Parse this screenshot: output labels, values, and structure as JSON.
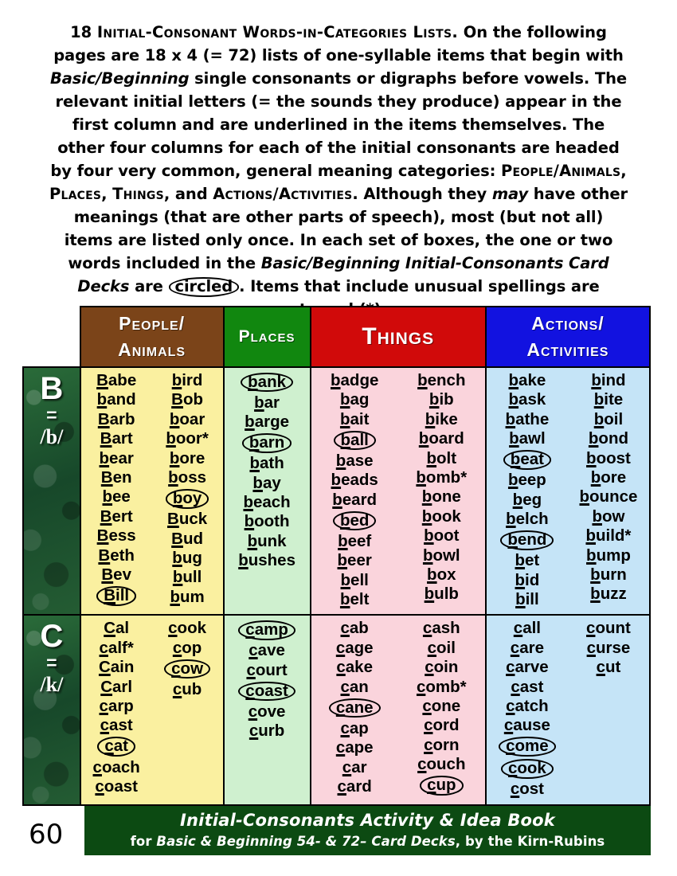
{
  "intro": {
    "lead_number": "18",
    "lead_title": "Initial-Consonant Words-in-Categories Lists.",
    "s1": " On the following pages are 18 x 4 (= 72) lists of one-syllable items that begin with ",
    "s1_it": "Basic/Beginning",
    "s2": " single consonants or digraphs before vowels. The relevant initial letters (= the sounds they produce) appear in the first column and are underlined in the items themselves. The other four columns for each of the initial consonants are headed by four very common, general meaning categories: ",
    "cat1": "People/Animals",
    "cat_sep1": ", ",
    "cat2": "Places",
    "cat_sep2": ", ",
    "cat3": "Things",
    "cat_sep3": ", and ",
    "cat4": "Actions/Activities",
    "s3": ". Although they ",
    "s3_it": "may",
    "s4": " have other meanings (that are other parts of speech), most (but not all) items are listed only once. In each set of boxes, the one or two words included in the ",
    "s4_it": "Basic/Beginning Initial-Consonants Card Decks",
    "s5": " are ",
    "s5_circled": "circled",
    "s6": ". Items that include unusual spellings are starred (*)."
  },
  "table": {
    "headers": [
      {
        "line1": "People/",
        "line2": "Animals",
        "color": "#7B4419"
      },
      {
        "line1": "Places",
        "line2": "",
        "color": "#11870F"
      },
      {
        "line1": "Things",
        "line2": "",
        "color": "#D10A0A"
      },
      {
        "line1": "Actions/",
        "line2": "Activities",
        "color": "#1212E0"
      }
    ],
    "rows": [
      {
        "letter": "B",
        "equals": "=",
        "phoneme": "/b/",
        "people": {
          "left": [
            {
              "t": "Babe",
              "u": "B",
              "circled": false
            },
            {
              "t": "band",
              "u": "b",
              "circled": false
            },
            {
              "t": "Barb",
              "u": "B",
              "circled": false
            },
            {
              "t": "Bart",
              "u": "B",
              "circled": false
            },
            {
              "t": "bear",
              "u": "b",
              "circled": false
            },
            {
              "t": "Ben",
              "u": "B",
              "circled": false
            },
            {
              "t": "bee",
              "u": "b",
              "circled": false
            },
            {
              "t": "Bert",
              "u": "B",
              "circled": false
            },
            {
              "t": "Bess",
              "u": "B",
              "circled": false
            },
            {
              "t": "Beth",
              "u": "B",
              "circled": false
            },
            {
              "t": "Bev",
              "u": "B",
              "circled": false
            },
            {
              "t": "Bill",
              "u": "B",
              "circled": true
            }
          ],
          "right": [
            {
              "t": "bird",
              "u": "b",
              "circled": false
            },
            {
              "t": "Bob",
              "u": "B",
              "circled": false
            },
            {
              "t": "boar",
              "u": "b",
              "circled": false
            },
            {
              "t": "boor*",
              "u": "b",
              "circled": false
            },
            {
              "t": "bore",
              "u": "b",
              "circled": false
            },
            {
              "t": "boss",
              "u": "b",
              "circled": false
            },
            {
              "t": "boy",
              "u": "b",
              "circled": true
            },
            {
              "t": "Buck",
              "u": "B",
              "circled": false
            },
            {
              "t": "Bud",
              "u": "B",
              "circled": false
            },
            {
              "t": "bug",
              "u": "b",
              "circled": false
            },
            {
              "t": "bull",
              "u": "b",
              "circled": false
            },
            {
              "t": "bum",
              "u": "b",
              "circled": false
            }
          ]
        },
        "places": {
          "single": [
            {
              "t": "bank",
              "u": "b",
              "circled": true
            },
            {
              "t": "bar",
              "u": "b",
              "circled": false
            },
            {
              "t": "barge",
              "u": "b",
              "circled": false
            },
            {
              "t": "barn",
              "u": "b",
              "circled": true
            },
            {
              "t": "bath",
              "u": "b",
              "circled": false
            },
            {
              "t": "bay",
              "u": "b",
              "circled": false
            },
            {
              "t": "beach",
              "u": "b",
              "circled": false
            },
            {
              "t": "booth",
              "u": "b",
              "circled": false
            },
            {
              "t": "bunk",
              "u": "b",
              "circled": false
            },
            {
              "t": "bushes",
              "u": "b",
              "circled": false
            }
          ]
        },
        "things": {
          "left": [
            {
              "t": "badge",
              "u": "b",
              "circled": false
            },
            {
              "t": "bag",
              "u": "b",
              "circled": false
            },
            {
              "t": "bait",
              "u": "b",
              "circled": false
            },
            {
              "t": "ball",
              "u": "b",
              "circled": true
            },
            {
              "t": "base",
              "u": "b",
              "circled": false
            },
            {
              "t": "beads",
              "u": "b",
              "circled": false
            },
            {
              "t": "beard",
              "u": "b",
              "circled": false
            },
            {
              "t": "bed",
              "u": "b",
              "circled": true
            },
            {
              "t": "beef",
              "u": "b",
              "circled": false
            },
            {
              "t": "beer",
              "u": "b",
              "circled": false
            },
            {
              "t": "bell",
              "u": "b",
              "circled": false
            },
            {
              "t": "belt",
              "u": "b",
              "circled": false
            }
          ],
          "right": [
            {
              "t": "bench",
              "u": "b",
              "circled": false
            },
            {
              "t": "bib",
              "u": "b",
              "circled": false
            },
            {
              "t": "bike",
              "u": "b",
              "circled": false
            },
            {
              "t": "board",
              "u": "b",
              "circled": false
            },
            {
              "t": "bolt",
              "u": "b",
              "circled": false
            },
            {
              "t": "bomb*",
              "u": "b",
              "circled": false
            },
            {
              "t": "bone",
              "u": "b",
              "circled": false
            },
            {
              "t": "book",
              "u": "b",
              "circled": false
            },
            {
              "t": "boot",
              "u": "b",
              "circled": false
            },
            {
              "t": "bowl",
              "u": "b",
              "circled": false
            },
            {
              "t": "box",
              "u": "b",
              "circled": false
            },
            {
              "t": "bulb",
              "u": "b",
              "circled": false
            }
          ]
        },
        "actions": {
          "left": [
            {
              "t": "bake",
              "u": "b",
              "circled": false
            },
            {
              "t": "bask",
              "u": "b",
              "circled": false
            },
            {
              "t": "bathe",
              "u": "b",
              "circled": false
            },
            {
              "t": "bawl",
              "u": "b",
              "circled": false
            },
            {
              "t": "beat",
              "u": "b",
              "circled": true
            },
            {
              "t": "beep",
              "u": "b",
              "circled": false
            },
            {
              "t": "beg",
              "u": "b",
              "circled": false
            },
            {
              "t": "belch",
              "u": "b",
              "circled": false
            },
            {
              "t": "bend",
              "u": "b",
              "circled": true
            },
            {
              "t": "bet",
              "u": "b",
              "circled": false
            },
            {
              "t": "bid",
              "u": "b",
              "circled": false
            },
            {
              "t": "bill",
              "u": "b",
              "circled": false
            }
          ],
          "right": [
            {
              "t": "bind",
              "u": "b",
              "circled": false
            },
            {
              "t": "bite",
              "u": "b",
              "circled": false
            },
            {
              "t": "boil",
              "u": "b",
              "circled": false
            },
            {
              "t": "bond",
              "u": "b",
              "circled": false
            },
            {
              "t": "boost",
              "u": "b",
              "circled": false
            },
            {
              "t": "bore",
              "u": "b",
              "circled": false
            },
            {
              "t": "bounce",
              "u": "b",
              "circled": false
            },
            {
              "t": "bow",
              "u": "b",
              "circled": false
            },
            {
              "t": "build*",
              "u": "b",
              "circled": false
            },
            {
              "t": "bump",
              "u": "b",
              "circled": false
            },
            {
              "t": "burn",
              "u": "b",
              "circled": false
            },
            {
              "t": "buzz",
              "u": "b",
              "circled": false
            }
          ]
        }
      },
      {
        "letter": "C",
        "equals": "=",
        "phoneme": "/k/",
        "people": {
          "left": [
            {
              "t": "Cal",
              "u": "C",
              "circled": false
            },
            {
              "t": "calf*",
              "u": "c",
              "circled": false
            },
            {
              "t": "Cain",
              "u": "C",
              "circled": false
            },
            {
              "t": "Carl",
              "u": "C",
              "circled": false
            },
            {
              "t": "carp",
              "u": "c",
              "circled": false
            },
            {
              "t": "cast",
              "u": "c",
              "circled": false
            },
            {
              "t": "cat",
              "u": "c",
              "circled": true
            },
            {
              "t": "coach",
              "u": "c",
              "circled": false
            },
            {
              "t": "coast",
              "u": "c",
              "circled": false
            }
          ],
          "right": [
            {
              "t": "cook",
              "u": "c",
              "circled": false
            },
            {
              "t": "cop",
              "u": "c",
              "circled": false
            },
            {
              "t": "cow",
              "u": "c",
              "circled": true
            },
            {
              "t": "cub",
              "u": "c",
              "circled": false
            }
          ]
        },
        "places": {
          "single": [
            {
              "t": "camp",
              "u": "c",
              "circled": true
            },
            {
              "t": "cave",
              "u": "c",
              "circled": false
            },
            {
              "t": "court",
              "u": "c",
              "circled": false
            },
            {
              "t": "coast",
              "u": "c",
              "circled": true
            },
            {
              "t": "cove",
              "u": "c",
              "circled": false
            },
            {
              "t": "curb",
              "u": "c",
              "circled": false
            }
          ]
        },
        "things": {
          "left": [
            {
              "t": "cab",
              "u": "c",
              "circled": false
            },
            {
              "t": "cage",
              "u": "c",
              "circled": false
            },
            {
              "t": "cake",
              "u": "c",
              "circled": false
            },
            {
              "t": "can",
              "u": "c",
              "circled": false
            },
            {
              "t": "cane",
              "u": "c",
              "circled": true
            },
            {
              "t": "cap",
              "u": "c",
              "circled": false
            },
            {
              "t": "cape",
              "u": "c",
              "circled": false
            },
            {
              "t": "car",
              "u": "c",
              "circled": false
            },
            {
              "t": "card",
              "u": "c",
              "circled": false
            }
          ],
          "right": [
            {
              "t": "cash",
              "u": "c",
              "circled": false
            },
            {
              "t": "coil",
              "u": "c",
              "circled": false
            },
            {
              "t": "coin",
              "u": "c",
              "circled": false
            },
            {
              "t": "comb*",
              "u": "c",
              "circled": false
            },
            {
              "t": "cone",
              "u": "c",
              "circled": false
            },
            {
              "t": "cord",
              "u": "c",
              "circled": false
            },
            {
              "t": "corn",
              "u": "c",
              "circled": false
            },
            {
              "t": "couch",
              "u": "c",
              "circled": false
            },
            {
              "t": "cup",
              "u": "c",
              "circled": true
            }
          ]
        },
        "actions": {
          "left": [
            {
              "t": "call",
              "u": "c",
              "circled": false
            },
            {
              "t": "care",
              "u": "c",
              "circled": false
            },
            {
              "t": "carve",
              "u": "c",
              "circled": false
            },
            {
              "t": "cast",
              "u": "c",
              "circled": false
            },
            {
              "t": "catch",
              "u": "c",
              "circled": false
            },
            {
              "t": "cause",
              "u": "c",
              "circled": false
            },
            {
              "t": "come",
              "u": "c",
              "circled": true
            },
            {
              "t": "cook",
              "u": "c",
              "circled": true
            },
            {
              "t": "cost",
              "u": "c",
              "circled": false
            }
          ],
          "right": [
            {
              "t": "count",
              "u": "c",
              "circled": false
            },
            {
              "t": "curse",
              "u": "c",
              "circled": false
            },
            {
              "t": "cut",
              "u": "c",
              "circled": false
            }
          ]
        }
      }
    ]
  },
  "footer": {
    "page_number": "60",
    "line1": "Initial-Consonants Activity & Idea Book",
    "line2_pre": "for ",
    "line2_it": "Basic & Beginning 54- & 72– Card Decks",
    "line2_post": ", by the Kirn-Rubins"
  }
}
